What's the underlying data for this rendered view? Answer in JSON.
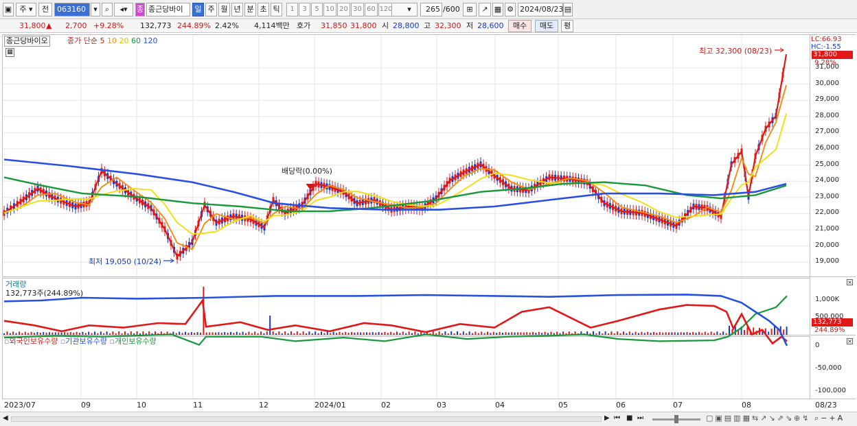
{
  "toolbar": {
    "period_a": "주",
    "period_b": "전",
    "code": "063160",
    "stock_name": "종근당바이",
    "tabs": [
      "일",
      "주",
      "월",
      "년",
      "분",
      "초",
      "틱"
    ],
    "active_tab": "일",
    "intervals": [
      "1",
      "3",
      "5",
      "10",
      "20",
      "30",
      "60",
      "120"
    ],
    "count": "265",
    "count_total": "/600",
    "date": "2024/08/23"
  },
  "quote": {
    "price": "31,800",
    "up_mark": "▲",
    "change": "2,700",
    "change_pct": "+9.28%",
    "volume": "132,773",
    "volume_ratio": "244.89%",
    "turnover": "2.42%",
    "amount": "4,114백만",
    "hoga_label": "호가",
    "hoga_ask": "31,850",
    "hoga_bid": "31,800",
    "open_label": "시",
    "open": "28,800",
    "high_label": "고",
    "high": "32,300",
    "low_label": "저",
    "low": "28,600",
    "buy": "매수",
    "sell": "매도",
    "avg": "평"
  },
  "price_pane": {
    "stock_label": "종근당바이오",
    "legend_prefix": "종가 단순",
    "ma": [
      {
        "label": "5",
        "color": "#e01818"
      },
      {
        "label": "10",
        "color": "#f09018"
      },
      {
        "label": "20",
        "color": "#f0e018"
      },
      {
        "label": "60",
        "color": "#18983a"
      },
      {
        "label": "120",
        "color": "#2850e0"
      }
    ],
    "lc": "LC:66.93",
    "hc": "HC:-1.55",
    "last_price": "31,800",
    "last_pct": "9.28%",
    "high_note": "최고 32,300 (08/23)",
    "low_note": "최저 19,050 (10/24)",
    "dividend_note": "배당락(0.00%)",
    "y_ticks": [
      "31,000",
      "30,000",
      "29,000",
      "28,000",
      "27,000",
      "26,000",
      "25,000",
      "24,000",
      "23,000",
      "22,000",
      "21,000",
      "20,000",
      "19,000"
    ]
  },
  "volume_pane": {
    "title": "거래량",
    "summary": "132,773주(244.89%)",
    "y_ticks": [
      "1,000K",
      "500,000"
    ],
    "last": "132,773",
    "last_pct": "244.89%"
  },
  "holding_pane": {
    "series": [
      {
        "label": "외국인보유수량",
        "color": "#d01818"
      },
      {
        "label": "기관보유수량",
        "color": "#2850e0"
      },
      {
        "label": "개인보유수량",
        "color": "#18983a"
      }
    ],
    "y_ticks": [
      "0",
      "-50,000",
      "-100,000"
    ]
  },
  "x_axis": {
    "labels": [
      "2023/07",
      "09",
      "10",
      "11",
      "12",
      "2024/01",
      "02",
      "03",
      "04",
      "05",
      "06",
      "07",
      "08"
    ],
    "end_label": "08/23"
  },
  "colors": {
    "up": "#d01818",
    "down": "#1838c8",
    "ma5": "#e01818",
    "ma10": "#f09018",
    "ma20": "#f0e018",
    "ma60": "#18983a",
    "ma120": "#2850e0"
  }
}
